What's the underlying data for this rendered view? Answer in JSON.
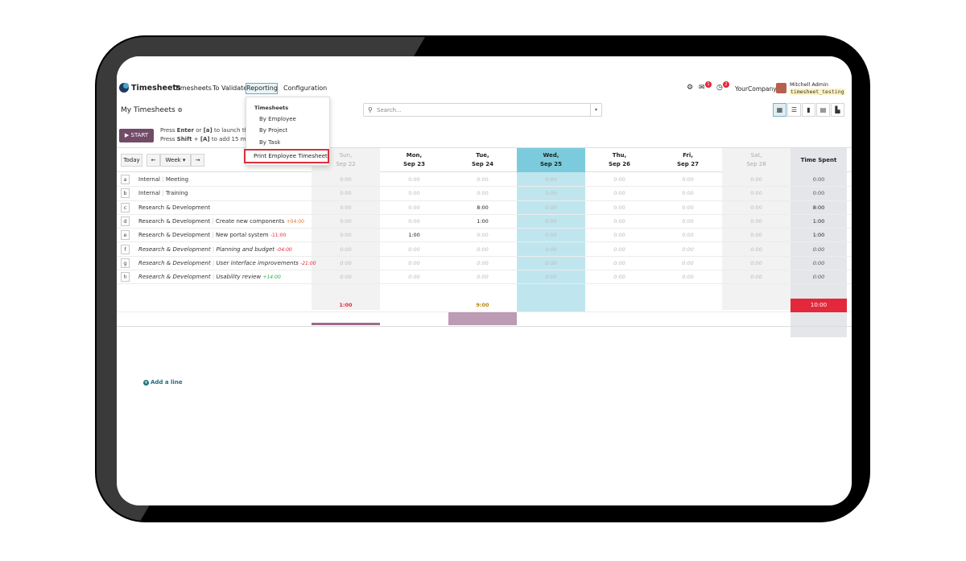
{
  "app": {
    "title": "Timesheets"
  },
  "menu": {
    "timesheets": "Timesheets",
    "to_validate": "To Validate",
    "reporting": "Reporting",
    "configuration": "Configuration"
  },
  "reporting_menu": {
    "section": "Timesheets",
    "items": [
      "By Employee",
      "By Project",
      "By Task"
    ],
    "highlighted": "Print Employee Timesheet"
  },
  "user": {
    "company": "YourCompany",
    "name": "Mitchell Admin",
    "database": "timesheet_testing",
    "messages_badge": "1",
    "activity_badge": "2"
  },
  "control": {
    "page_title": "My Timesheets",
    "search_placeholder": "Search...",
    "start_label": "START"
  },
  "hints": {
    "line1_pre": "Press ",
    "line1_key": "Enter",
    "line1_mid": " or ",
    "line1_key2": "[a]",
    "line1_post": " to launch the tir",
    "line2_pre": "Press ",
    "line2_key": "Shift",
    "line2_mid": " + ",
    "line2_key2": "[A]",
    "line2_post": " to add 15 min"
  },
  "grid": {
    "today_btn": "Today",
    "prev_icon": "←",
    "range_btn": "Week ▾",
    "next_icon": "→",
    "columns": [
      {
        "day": "Sun,",
        "date": "Sep 22"
      },
      {
        "day": "Mon,",
        "date": "Sep 23"
      },
      {
        "day": "Tue,",
        "date": "Sep 24"
      },
      {
        "day": "Wed,",
        "date": "Sep 25"
      },
      {
        "day": "Thu,",
        "date": "Sep 26"
      },
      {
        "day": "Fri,",
        "date": "Sep 27"
      },
      {
        "day": "Sat,",
        "date": "Sep 28"
      }
    ],
    "total_header": "Time Spent",
    "rows": [
      {
        "key": "a",
        "project": "Internal",
        "task": "Meeting",
        "extra": "",
        "values": [
          "0:00",
          "0:00",
          "0:00",
          "0:00",
          "0:00",
          "0:00",
          "0:00"
        ],
        "total": "0:00"
      },
      {
        "key": "b",
        "project": "Internal",
        "task": "Training",
        "extra": "",
        "values": [
          "0:00",
          "0:00",
          "0:00",
          "0:00",
          "0:00",
          "0:00",
          "0:00"
        ],
        "total": "0:00"
      },
      {
        "key": "c",
        "project": "Research & Development",
        "task": "",
        "extra": "",
        "values": [
          "0:00",
          "0:00",
          "8:00",
          "0:00",
          "0:00",
          "0:00",
          "0:00"
        ],
        "total": "8:00"
      },
      {
        "key": "d",
        "project": "Research & Development",
        "task": "Create new components",
        "extra": "+04:00",
        "values": [
          "0:00",
          "0:00",
          "1:00",
          "0:00",
          "0:00",
          "0:00",
          "0:00"
        ],
        "total": "1:00"
      },
      {
        "key": "e",
        "project": "Research & Development",
        "task": "New portal system",
        "extra": "-11:00",
        "values": [
          "0:00",
          "1:00",
          "0:00",
          "0:00",
          "0:00",
          "0:00",
          "0:00"
        ],
        "total": "1:00"
      },
      {
        "key": "f",
        "project": "Research & Development",
        "task": "Planning and budget",
        "extra": "-04:00",
        "values": [
          "0:00",
          "0:00",
          "0:00",
          "0:00",
          "0:00",
          "0:00",
          "0:00"
        ],
        "total": "0:00"
      },
      {
        "key": "g",
        "project": "Research & Development",
        "task": "User interface improvements",
        "extra": "-21:00",
        "values": [
          "0:00",
          "0:00",
          "0:00",
          "0:00",
          "0:00",
          "0:00",
          "0:00"
        ],
        "total": "0:00"
      },
      {
        "key": "h",
        "project": "Research & Development",
        "task": "Usability review",
        "extra": "+14:00",
        "values": [
          "0:00",
          "0:00",
          "0:00",
          "0:00",
          "0:00",
          "0:00",
          "0:00"
        ],
        "total": "0:00"
      }
    ],
    "add_line": "Add a line",
    "totals": [
      "",
      "1:00",
      "",
      "9:00",
      "",
      "",
      "",
      ""
    ],
    "grand_total": "10:00"
  },
  "colors": {
    "brand": "#714b67",
    "today": "#7ccbdc",
    "alert": "#e3283b",
    "highlight": "#d9303a"
  }
}
